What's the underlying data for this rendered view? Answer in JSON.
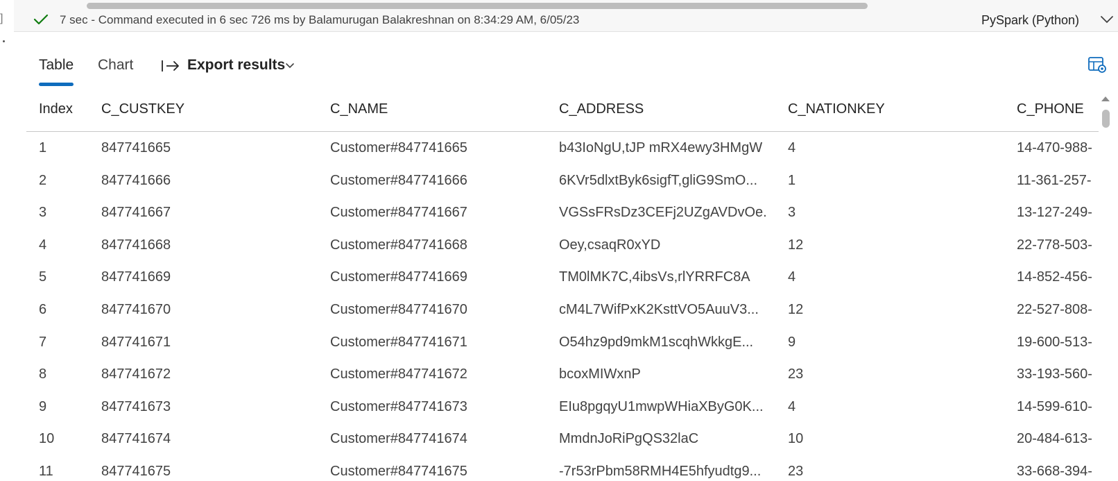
{
  "status": {
    "check_icon": "checkmark-icon",
    "text": "7 sec - Command executed in 6 sec 726 ms by Balamurugan Balakreshnan on 8:34:29 AM, 6/05/23",
    "language": "PySpark (Python)",
    "left_bracket": "]",
    "success_color": "#107c10"
  },
  "tabs": [
    {
      "label": "Table"
    },
    {
      "label": "Chart"
    }
  ],
  "export": {
    "label": "Export results"
  },
  "accent_color": "#0f6cbd",
  "table": {
    "headers": [
      "Index",
      "C_CUSTKEY",
      "C_NAME",
      "C_ADDRESS",
      "C_NATIONKEY",
      "C_PHONE"
    ],
    "rows": [
      [
        "1",
        "847741665",
        "Customer#847741665",
        "b43IoNgU,tJP mRX4ewy3HMgW",
        "4",
        "14-470-988-"
      ],
      [
        "2",
        "847741666",
        "Customer#847741666",
        "6KVr5dlxtByk6sigfT,gliG9SmO...",
        "1",
        "11-361-257-"
      ],
      [
        "3",
        "847741667",
        "Customer#847741667",
        "VGSsFRsDz3CEFj2UZgAVDvOe...",
        "3",
        "13-127-249-"
      ],
      [
        "4",
        "847741668",
        "Customer#847741668",
        "Oey,csaqR0xYD",
        "12",
        "22-778-503-"
      ],
      [
        "5",
        "847741669",
        "Customer#847741669",
        "TM0lMK7C,4ibsVs,rlYRRFC8A",
        "4",
        "14-852-456-"
      ],
      [
        "6",
        "847741670",
        "Customer#847741670",
        "cM4L7WifPxK2KsttVO5AuuV3...",
        "12",
        "22-527-808-"
      ],
      [
        "7",
        "847741671",
        "Customer#847741671",
        "O54hz9pd9mkM1scqhWkkgE...",
        "9",
        "19-600-513-"
      ],
      [
        "8",
        "847741672",
        "Customer#847741672",
        "bcoxMIWxnP",
        "23",
        "33-193-560-"
      ],
      [
        "9",
        "847741673",
        "Customer#847741673",
        "EIu8pgqyU1mwpWHiaXByG0K...",
        "4",
        "14-599-610-"
      ],
      [
        "10",
        "847741674",
        "Customer#847741674",
        "MmdnJoRiPgQS32laC",
        "10",
        "20-484-613-"
      ],
      [
        "11",
        "847741675",
        "Customer#847741675",
        "-7r53rPbm58RMH4E5hfyudtg9...",
        "23",
        "33-668-394-"
      ]
    ]
  }
}
